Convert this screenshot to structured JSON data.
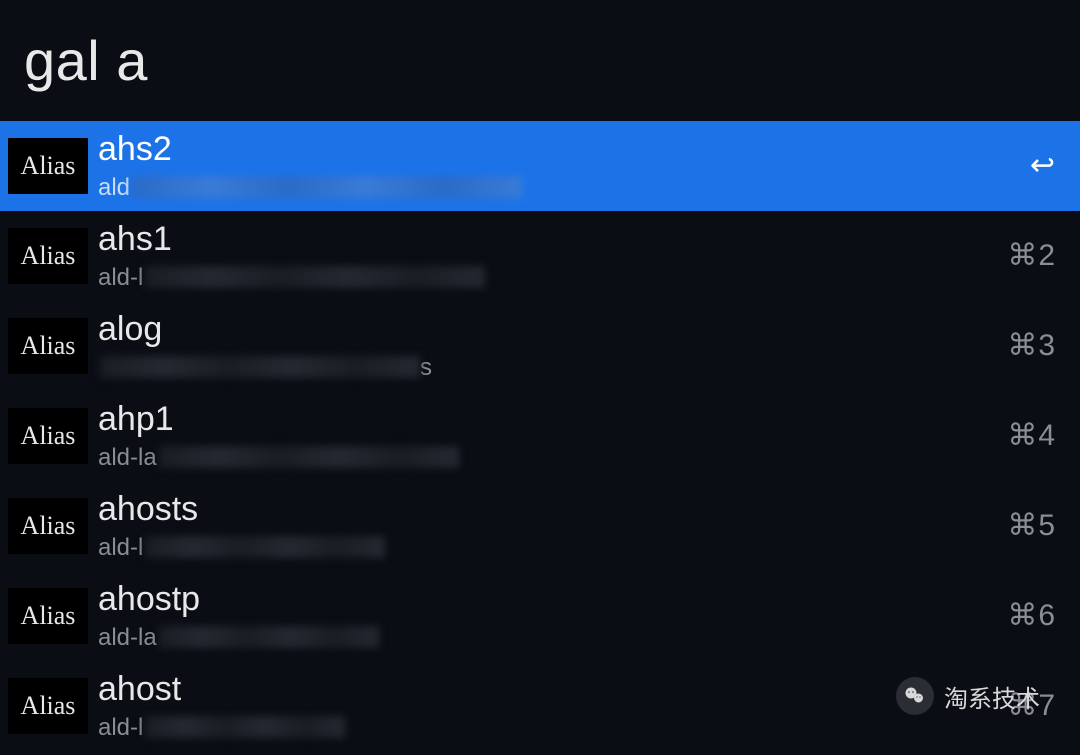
{
  "search": {
    "query": "gal a"
  },
  "badge_label": "Alias",
  "results": [
    {
      "title": "ahs2",
      "subtitle_prefix": "ald",
      "redacted_width": 390,
      "shortcut": "↩",
      "shortcut_type": "enter",
      "selected": true
    },
    {
      "title": "ahs1",
      "subtitle_prefix": "ald-l",
      "redacted_width": 340,
      "shortcut": "⌘2",
      "shortcut_type": "cmd",
      "selected": false
    },
    {
      "title": "alog",
      "subtitle_prefix": "",
      "subtitle_suffix": "s",
      "redacted_width": 320,
      "shortcut": "⌘3",
      "shortcut_type": "cmd",
      "selected": false
    },
    {
      "title": "ahp1",
      "subtitle_prefix": "ald-la",
      "redacted_width": 300,
      "shortcut": "⌘4",
      "shortcut_type": "cmd",
      "selected": false
    },
    {
      "title": "ahosts",
      "subtitle_prefix": "ald-l",
      "redacted_width": 240,
      "shortcut": "⌘5",
      "shortcut_type": "cmd",
      "selected": false
    },
    {
      "title": "ahostp",
      "subtitle_prefix": "ald-la",
      "redacted_width": 220,
      "shortcut": "⌘6",
      "shortcut_type": "cmd",
      "selected": false
    },
    {
      "title": "ahost",
      "subtitle_prefix": "ald-l",
      "redacted_width": 200,
      "shortcut": "⌘7",
      "shortcut_type": "cmd",
      "selected": false
    }
  ],
  "watermark": {
    "text": "淘系技术"
  }
}
